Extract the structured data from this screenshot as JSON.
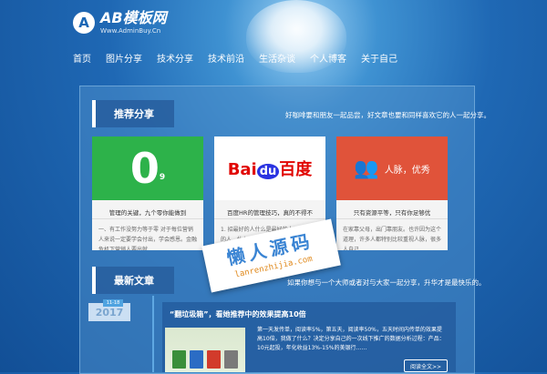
{
  "logo": {
    "mark": "A",
    "title": "AB模板网",
    "subtitle": "Www.AdminBuy.Cn"
  },
  "nav": [
    "首页",
    "图片分享",
    "技术分享",
    "技术前沿",
    "生活杂谈",
    "个人博客",
    "关于自己"
  ],
  "recommend": {
    "heading": "推荐分享",
    "tagline": "好咖啡要和朋友一起品尝，好文章也要和同样喜欢它的人一起分享。",
    "cards": [
      {
        "logo": "0",
        "title": "管理的关键，九个零你能做到",
        "desc": "一、有工作没努力等于零 对于每位营销人来说一定要学会付出，学会感恩。金融危机下营销人要出就……"
      },
      {
        "logo": "Baidu百度",
        "title": "百度HR的管理技巧，真的不得不",
        "desc": "1. 招最好的人什么是最好的人？ 招最好的人。什么是最好的人？什么样的人是最好的人？……"
      },
      {
        "logo": "人脉，优秀",
        "title": "只有资源平等，只有你足够优",
        "desc": "在家靠父母，出门靠朋友。也许因为这个道理，许多人都特别比较重视人脉，很多人自己……"
      }
    ]
  },
  "latest": {
    "heading": "最新文章",
    "tagline": "如果你想与一个大师或者对与大家一起分享，升华才是最快乐的。",
    "date": "11-18",
    "year": "2017",
    "article": {
      "title": "“翻垃圾箱”，看她推荐中的效果提高10倍",
      "desc": "第一天发传单，阅读率5%，第五天，阅读率50%，五天时间内传单的效果提高10倍，我做了什么？决定分享自己的一次线下推广的数据分析过程：产品：10元起投，年化收益13%-15%的美银行……",
      "button": "阅读全文>>"
    }
  },
  "watermark": {
    "cn": "懒人源码",
    "en": "lanrenzhijia.com"
  },
  "colors": {
    "accent": "#2db24a",
    "brand_red": "#e0533a",
    "baidu_blue": "#2932e1",
    "baidu_red": "#e10602"
  }
}
